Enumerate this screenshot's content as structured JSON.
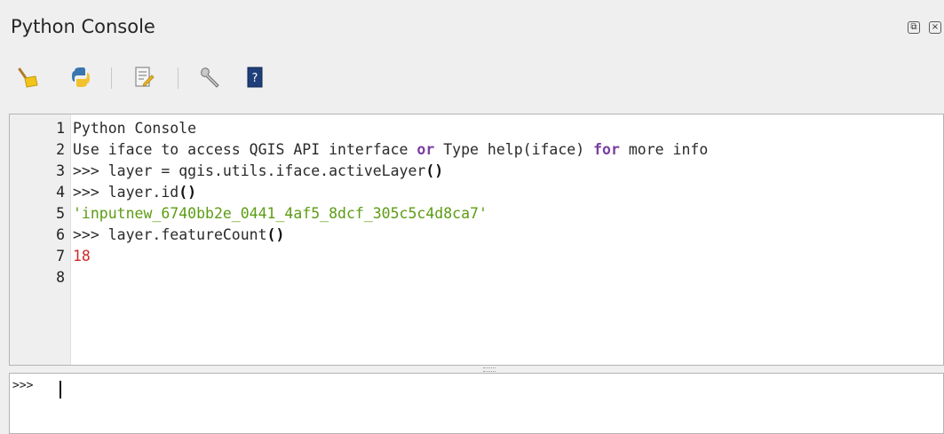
{
  "window": {
    "title": "Python Console",
    "float_glyph": "⧉",
    "close_glyph": "×"
  },
  "toolbar": {
    "buttons": [
      {
        "name": "clear-console",
        "icon": "broom-icon"
      },
      {
        "name": "run-command",
        "icon": "python-run-icon"
      },
      {
        "name": "show-editor",
        "icon": "editor-icon"
      },
      {
        "name": "options",
        "icon": "wrench-icon"
      },
      {
        "name": "help",
        "icon": "help-book-icon"
      }
    ]
  },
  "console": {
    "lines": [
      {
        "n": "1",
        "segments": [
          {
            "t": "Python Console",
            "c": "plain"
          }
        ]
      },
      {
        "n": "2",
        "segments": [
          {
            "t": "Use iface to access QGIS API interface ",
            "c": "plain"
          },
          {
            "t": "or",
            "c": "kw"
          },
          {
            "t": " Type help(iface) ",
            "c": "plain"
          },
          {
            "t": "for",
            "c": "kw"
          },
          {
            "t": " more info",
            "c": "plain"
          }
        ]
      },
      {
        "n": "3",
        "segments": [
          {
            "t": ">>> layer = qgis.utils.iface.activeLayer",
            "c": "plain"
          },
          {
            "t": "()",
            "c": "paren"
          }
        ]
      },
      {
        "n": "4",
        "segments": [
          {
            "t": ">>> layer.id",
            "c": "plain"
          },
          {
            "t": "()",
            "c": "paren"
          }
        ]
      },
      {
        "n": "5",
        "segments": [
          {
            "t": "'inputnew_6740bb2e_0441_4af5_8dcf_305c5c4d8ca7'",
            "c": "str"
          }
        ]
      },
      {
        "n": "6",
        "segments": [
          {
            "t": ">>> layer.featureCount",
            "c": "plain"
          },
          {
            "t": "()",
            "c": "paren"
          }
        ]
      },
      {
        "n": "7",
        "segments": [
          {
            "t": "18",
            "c": "num"
          }
        ]
      },
      {
        "n": "8",
        "segments": []
      }
    ]
  },
  "input": {
    "prompt": ">>>",
    "value": ""
  },
  "colors": {
    "keyword": "#7b3fa0",
    "string": "#5c9c13",
    "number": "#d12a2a"
  }
}
